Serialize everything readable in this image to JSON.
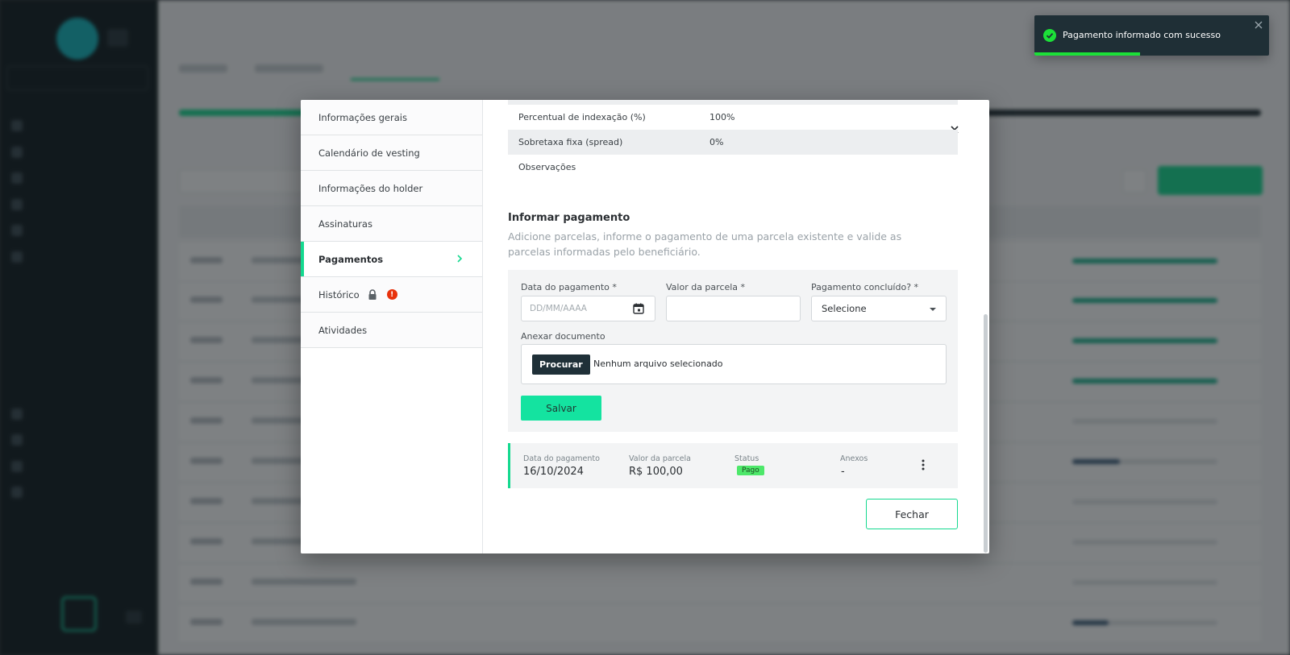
{
  "modal": {
    "nav_items": [
      {
        "label": "Informações gerais"
      },
      {
        "label": "Calendário de vesting"
      },
      {
        "label": "Informações do holder"
      },
      {
        "label": "Assinaturas"
      },
      {
        "label": "Pagamentos"
      },
      {
        "label": "Histórico"
      },
      {
        "label": "Atividades"
      }
    ],
    "active_nav": "Pagamentos",
    "info_rows": [
      {
        "label": "Percentual de indexação (%)",
        "value": "100%"
      },
      {
        "label": "Sobretaxa fixa (spread)",
        "value": "0%"
      },
      {
        "label": "Observações",
        "value": ""
      }
    ],
    "section": {
      "title": "Informar pagamento",
      "description": "Adicione parcelas, informe o pagamento de uma parcela existente e valide as parcelas informadas pelo beneficiário."
    },
    "form": {
      "date_label": "Data do pagamento *",
      "date_placeholder": "DD/MM/AAAA",
      "value_label": "Valor da parcela *",
      "value_value": "",
      "done_label": "Pagamento concluído? *",
      "done_selected": "Selecione",
      "attach_label": "Anexar documento",
      "browse_label": "Procurar",
      "no_file_text": "Nenhum arquivo selecionado",
      "save_label": "Salvar"
    },
    "payment": {
      "date_label": "Data do pagamento",
      "date_value": "16/10/2024",
      "value_label": "Valor da parcela",
      "value_value": "R$ 100,00",
      "status_label": "Status",
      "status_value": "Pago",
      "attachments_label": "Anexos",
      "attachments_value": "-"
    },
    "close_label": "Fechar"
  },
  "toast": {
    "message": "Pagamento informado com sucesso",
    "progress": 0.45
  },
  "colors": {
    "accent": "#14d98f",
    "toast_bg": "#1f2f36",
    "badge_paid": "#4de86a"
  }
}
